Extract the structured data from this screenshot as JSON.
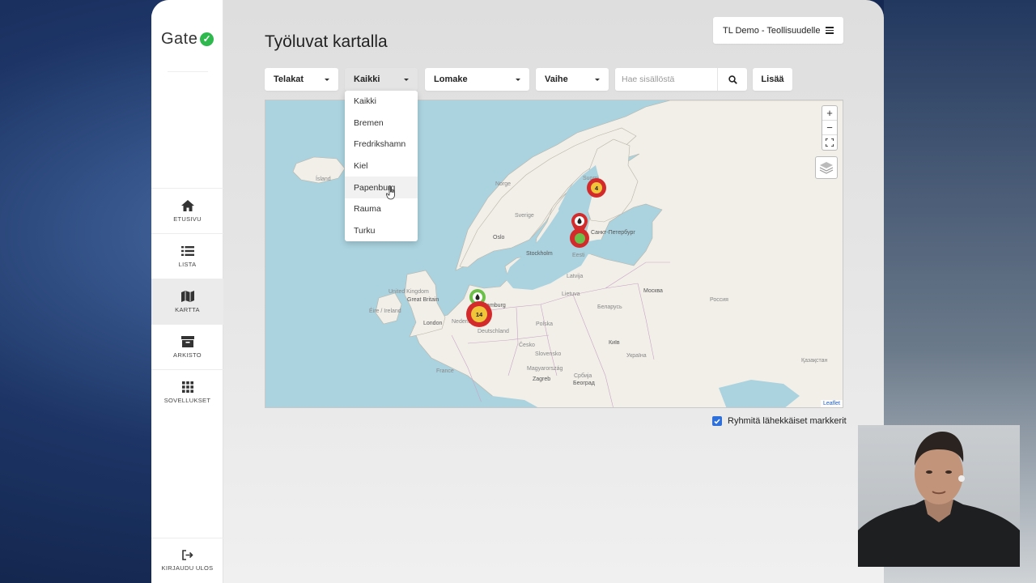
{
  "brand": {
    "name": "Gate"
  },
  "sidebar": {
    "items": [
      {
        "label": "ETUSIVU",
        "icon": "home-icon"
      },
      {
        "label": "LISTA",
        "icon": "list-icon"
      },
      {
        "label": "KARTTA",
        "icon": "map-icon",
        "active": true
      },
      {
        "label": "ARKISTO",
        "icon": "archive-icon"
      },
      {
        "label": "SOVELLUKSET",
        "icon": "apps-grid-icon"
      }
    ],
    "logout_label": "KIRJAUDU ULOS"
  },
  "header": {
    "title": "Työluvat kartalla",
    "org_menu_label": "TL Demo - Teollisuudelle"
  },
  "filters": {
    "shipyard": "Telakat",
    "location": "Kaikki",
    "form": "Lomake",
    "phase": "Vaihe",
    "search_placeholder": "Hae sisällöstä",
    "add_label": "Lisää"
  },
  "dropdown": {
    "options": [
      "Kaikki",
      "Bremen",
      "Fredrikshamn",
      "Kiel",
      "Papenburg",
      "Rauma",
      "Turku"
    ],
    "hovered": "Papenburg"
  },
  "map": {
    "zoom_in": "+",
    "zoom_out": "−",
    "attribution": "Leaflet",
    "labels": {
      "iceland": "Ísland",
      "norway": "Norge",
      "sweden": "Sverige",
      "suomi": "Suomi",
      "oslo": "Oslo",
      "stockholm": "Stockholm",
      "spb": "Санкт-Петербург",
      "eesti": "Eesti",
      "latvija": "Latvija",
      "lietuva": "Lietuva",
      "uk": "United Kingdom",
      "gb": "Great Britain",
      "ireland": "Éire / Ireland",
      "london": "London",
      "nederland": "Nederland",
      "hamburg": "Hamburg",
      "deutschland": "Deutschland",
      "polska": "Polska",
      "belarus": "Беларусь",
      "moscow": "Москва",
      "russia": "Россия",
      "cesko": "Česko",
      "slovensko": "Slovensko",
      "france": "France",
      "magyar": "Magyarország",
      "zagreb": "Zagreb",
      "srbija": "Србија",
      "kyiv": "Київ",
      "ukraina": "Україна",
      "kazakh": "Қазақстан",
      "beograd": "Београд"
    },
    "markers": [
      {
        "id": "suomi-north",
        "count": "4",
        "color": "#d32b2b"
      },
      {
        "id": "finland-pin",
        "count": "",
        "color": "#d32b2b"
      },
      {
        "id": "helsinki-cluster",
        "count": "",
        "color": "#d32b2b"
      },
      {
        "id": "hamburg-pin",
        "count": "",
        "color": "#6cc04a"
      },
      {
        "id": "papenburg-cluster",
        "count": "14",
        "color": "#d32b2b"
      }
    ]
  },
  "options": {
    "group_markers_label": "Ryhmitä lähekkäiset markkerit",
    "group_markers_checked": true
  }
}
